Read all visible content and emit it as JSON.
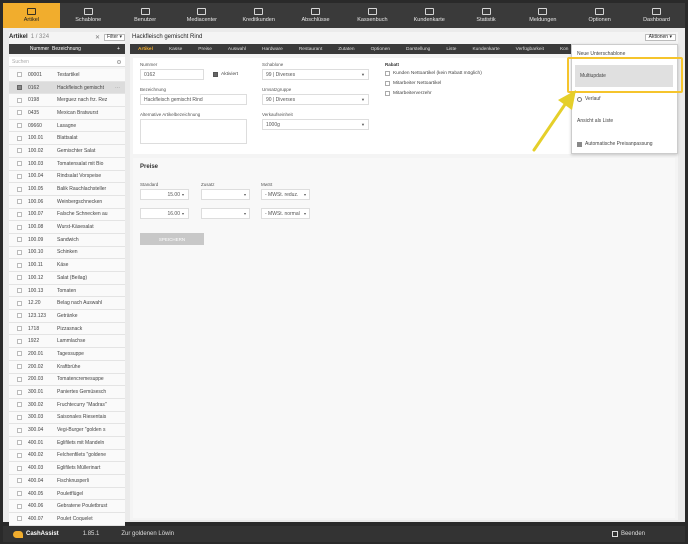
{
  "nav": [
    {
      "label": "Artikel",
      "icon": "box-icon",
      "active": true
    },
    {
      "label": "Schablone",
      "icon": "template-icon"
    },
    {
      "label": "Benutzer",
      "icon": "users-icon"
    },
    {
      "label": "Mediacenter",
      "icon": "image-icon"
    },
    {
      "label": "Kreditkunden",
      "icon": "credit-icon"
    },
    {
      "label": "Abschlüsse",
      "icon": "report-icon"
    },
    {
      "label": "Kassenbuch",
      "icon": "book-icon"
    },
    {
      "label": "Kundenkarte",
      "icon": "card-icon"
    },
    {
      "label": "Statistik",
      "icon": "chart-icon"
    },
    {
      "label": "Meldungen",
      "icon": "mail-icon"
    },
    {
      "label": "Optionen",
      "icon": "gear-icon"
    },
    {
      "label": "Dashboard",
      "icon": "monitor-icon"
    }
  ],
  "list": {
    "title": "Artikel",
    "count": "1 / 324",
    "filter_label": "Filter",
    "col_number": "Nummer",
    "col_name": "Bezeichnung",
    "search_placeholder": "Suchen",
    "rows": [
      {
        "num": "00001",
        "name": "Testartikel"
      },
      {
        "num": "0162",
        "name": "Hackfleisch gemischt",
        "selected": true
      },
      {
        "num": "0198",
        "name": "Merguez nach frz. Rez"
      },
      {
        "num": "0435",
        "name": "Mexican Bratwurst"
      },
      {
        "num": "09660",
        "name": "Lasagne"
      },
      {
        "num": "100.01",
        "name": "Blattsalat"
      },
      {
        "num": "100.02",
        "name": "Gemischter Salat"
      },
      {
        "num": "100.03",
        "name": "Tomatensalat mit Bio"
      },
      {
        "num": "100.04",
        "name": "Rindsalat Vorspeise"
      },
      {
        "num": "100.05",
        "name": "Balik Rauchlachsteller"
      },
      {
        "num": "100.06",
        "name": "Weinbergschnecken"
      },
      {
        "num": "100.07",
        "name": "Falsche Schnecken au"
      },
      {
        "num": "100.08",
        "name": "Wurst-Käsesalat"
      },
      {
        "num": "100.09",
        "name": "Sandwich"
      },
      {
        "num": "100.10",
        "name": "Schinken"
      },
      {
        "num": "100.11",
        "name": "Käse"
      },
      {
        "num": "100.12",
        "name": "Salat (Beilag)"
      },
      {
        "num": "100.13",
        "name": "Tomaten"
      },
      {
        "num": "12.20",
        "name": "Belag nach Auswahl"
      },
      {
        "num": "123.123",
        "name": "Getränke"
      },
      {
        "num": "1718",
        "name": "Pizzasnack"
      },
      {
        "num": "1922",
        "name": "Lammlachse"
      },
      {
        "num": "200.01",
        "name": "Tagessuppe"
      },
      {
        "num": "200.02",
        "name": "Kraftbrühe"
      },
      {
        "num": "200.03",
        "name": "Tomatencremesuppe"
      },
      {
        "num": "300.01",
        "name": "Paniertes Gemüsesch"
      },
      {
        "num": "300.02",
        "name": "Fruchtecurry \"Madras\""
      },
      {
        "num": "300.03",
        "name": "Saisonales Riesentais"
      },
      {
        "num": "300.04",
        "name": "Vegi-Burger \"golden s"
      },
      {
        "num": "400.01",
        "name": "Eglifilets mit Mandeln"
      },
      {
        "num": "400.02",
        "name": "Felchenfilets \"goldene"
      },
      {
        "num": "400.03",
        "name": "Eglifilets Müllerinart"
      },
      {
        "num": "400.04",
        "name": "Fischknusperli"
      },
      {
        "num": "400.05",
        "name": "Pouletflügel"
      },
      {
        "num": "400.06",
        "name": "Gebratene Pouletbrust"
      },
      {
        "num": "400.07",
        "name": "Poulet Coquelet"
      }
    ]
  },
  "detail": {
    "title": "Hackfleisch gemischt Rind",
    "actions_label": "Aktionen",
    "tabs": [
      "Artikel",
      "Kasse",
      "Preise",
      "Auswahl",
      "Hardware",
      "Restaurant",
      "Zutaten",
      "Optionen",
      "Darstellung",
      "Liste",
      "Kundenkarte",
      "Verfügbarkeit",
      "Kon"
    ],
    "form": {
      "nummer_label": "Nummer",
      "nummer_value": "0162",
      "aktiviert_label": "Aktiviert",
      "bezeichnung_label": "Bezeichnung",
      "bezeichnung_value": "Hackfleisch gemischt Rind",
      "alt_label": "Alternative Artikelbezeichnung",
      "schablone_label": "Schablone",
      "schablone_value": "99 | Diverses",
      "umsatzgruppe_label": "Umsatzgruppe",
      "umsatzgruppe_value": "90 | Diverses",
      "verkaufseinheit_label": "Verkaufseinheit",
      "verkaufseinheit_value": "1000g",
      "rabatt_label": "Rabatt",
      "rabatt_opt1": "Kunden Nettoartikel (kein Rabatt möglich)",
      "rabatt_opt2": "Mitarbeiter Nettoartikel",
      "rabatt_opt3": "Mitarbeiterverzehr"
    },
    "preise": {
      "title": "Preise",
      "standard_label": "Standard",
      "zusatz_label": "Zusatz",
      "mwst_label": "MwSt",
      "price1": "15.00",
      "price2": "16.00",
      "mwst1": "- MWSt. reduz.",
      "mwst2": "- MWSt. normal",
      "save_label": "SPEICHERN"
    }
  },
  "menu": {
    "items": [
      {
        "label": "Neue Unterschablone"
      },
      {
        "label": "Multiupdate",
        "highlighted": true
      },
      {
        "label": "Verlauf",
        "icon": "clock-icon"
      },
      {
        "label": "Ansicht als Liste"
      },
      {
        "label": "Automatische Preisanpassung",
        "icon": "list-icon"
      }
    ]
  },
  "footer": {
    "brand": "CashAssist",
    "version": "1.85.1",
    "store": "Zur goldenen Löwin",
    "exit_label": "Beenden"
  },
  "colors": {
    "accent": "#f1ad2d",
    "highlight_frame": "#f5c42c",
    "arrow": "#e5cf2a"
  }
}
